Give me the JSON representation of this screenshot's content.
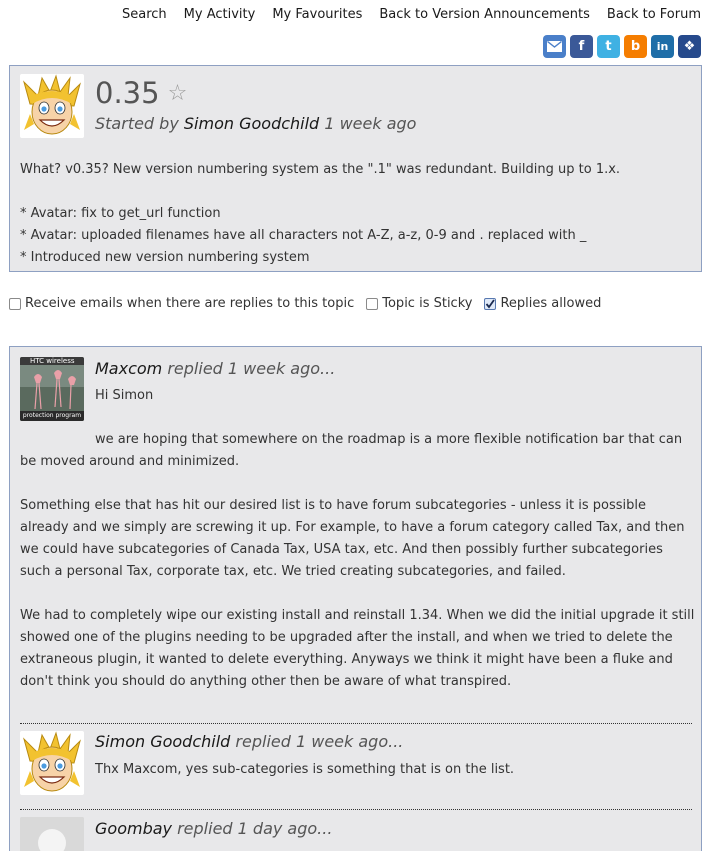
{
  "nav": [
    "Search",
    "My Activity",
    "My Favourites",
    "Back to Version Announcements",
    "Back to Forum"
  ],
  "share_icons": [
    {
      "name": "email-icon",
      "color": "#4a7fc9",
      "glyph": "✉"
    },
    {
      "name": "facebook-icon",
      "color": "#3b5998",
      "glyph": "f"
    },
    {
      "name": "twitter-icon",
      "color": "#3fb1e3",
      "glyph": "t"
    },
    {
      "name": "blogger-icon",
      "color": "#f57d00",
      "glyph": "b"
    },
    {
      "name": "linkedin-icon",
      "color": "#1f6ea8",
      "glyph": "in"
    },
    {
      "name": "myspace-icon",
      "color": "#264a8c",
      "glyph": "❖"
    }
  ],
  "topic": {
    "title": "0.35",
    "started_prefix": "Started by",
    "author": "Simon Goodchild",
    "time": "1 week ago",
    "body": [
      "What? v0.35? New version numbering system as the \".1\" was redundant. Building up to 1.x.",
      "",
      "* Avatar: fix to get_url function",
      "* Avatar: uploaded filenames have all characters not A-Z, a-z, 0-9 and . replaced with _",
      "* Introduced new version numbering system"
    ]
  },
  "options": {
    "receive_emails": {
      "label": "Receive emails when there are replies to this topic",
      "checked": false
    },
    "sticky": {
      "label": "Topic is Sticky",
      "checked": false
    },
    "replies_allowed": {
      "label": "Replies allowed",
      "checked": true
    }
  },
  "replies": [
    {
      "author": "Maxcom",
      "meta": "replied 1 week ago...",
      "avatar_top": "HTC wireless",
      "avatar_bottom": "protection program",
      "paragraphs": [
        "Hi Simon",
        "we are hoping that somewhere on the roadmap is a more flexible notification bar that can be moved around and minimized.",
        "Something else that has hit our desired list is to have forum subcategories - unless it is possible already and we simply are screwing it up. For example, to have a forum category called Tax, and then we could have subcategories of Canada Tax, USA tax, etc. And then possibly further subcategories such a personal Tax, corporate tax, etc. We tried creating subcategories, and failed.",
        "We had to completely wipe our existing install and reinstall 1.34. When we did the initial upgrade it still showed one of the plugins needing to be upgraded after the install, and when we tried to delete the extraneous plugin, it wanted to delete everything. Anyways we think it might have been a fluke and don't think you should do anything other then be aware of what transpired."
      ]
    },
    {
      "author": "Simon Goodchild",
      "meta": "replied 1 week ago...",
      "paragraphs": [
        "Thx Maxcom, yes sub-categories is something that is on the list."
      ]
    },
    {
      "author": "Goombay",
      "meta": "replied 1 day ago...",
      "paragraphs": []
    }
  ]
}
